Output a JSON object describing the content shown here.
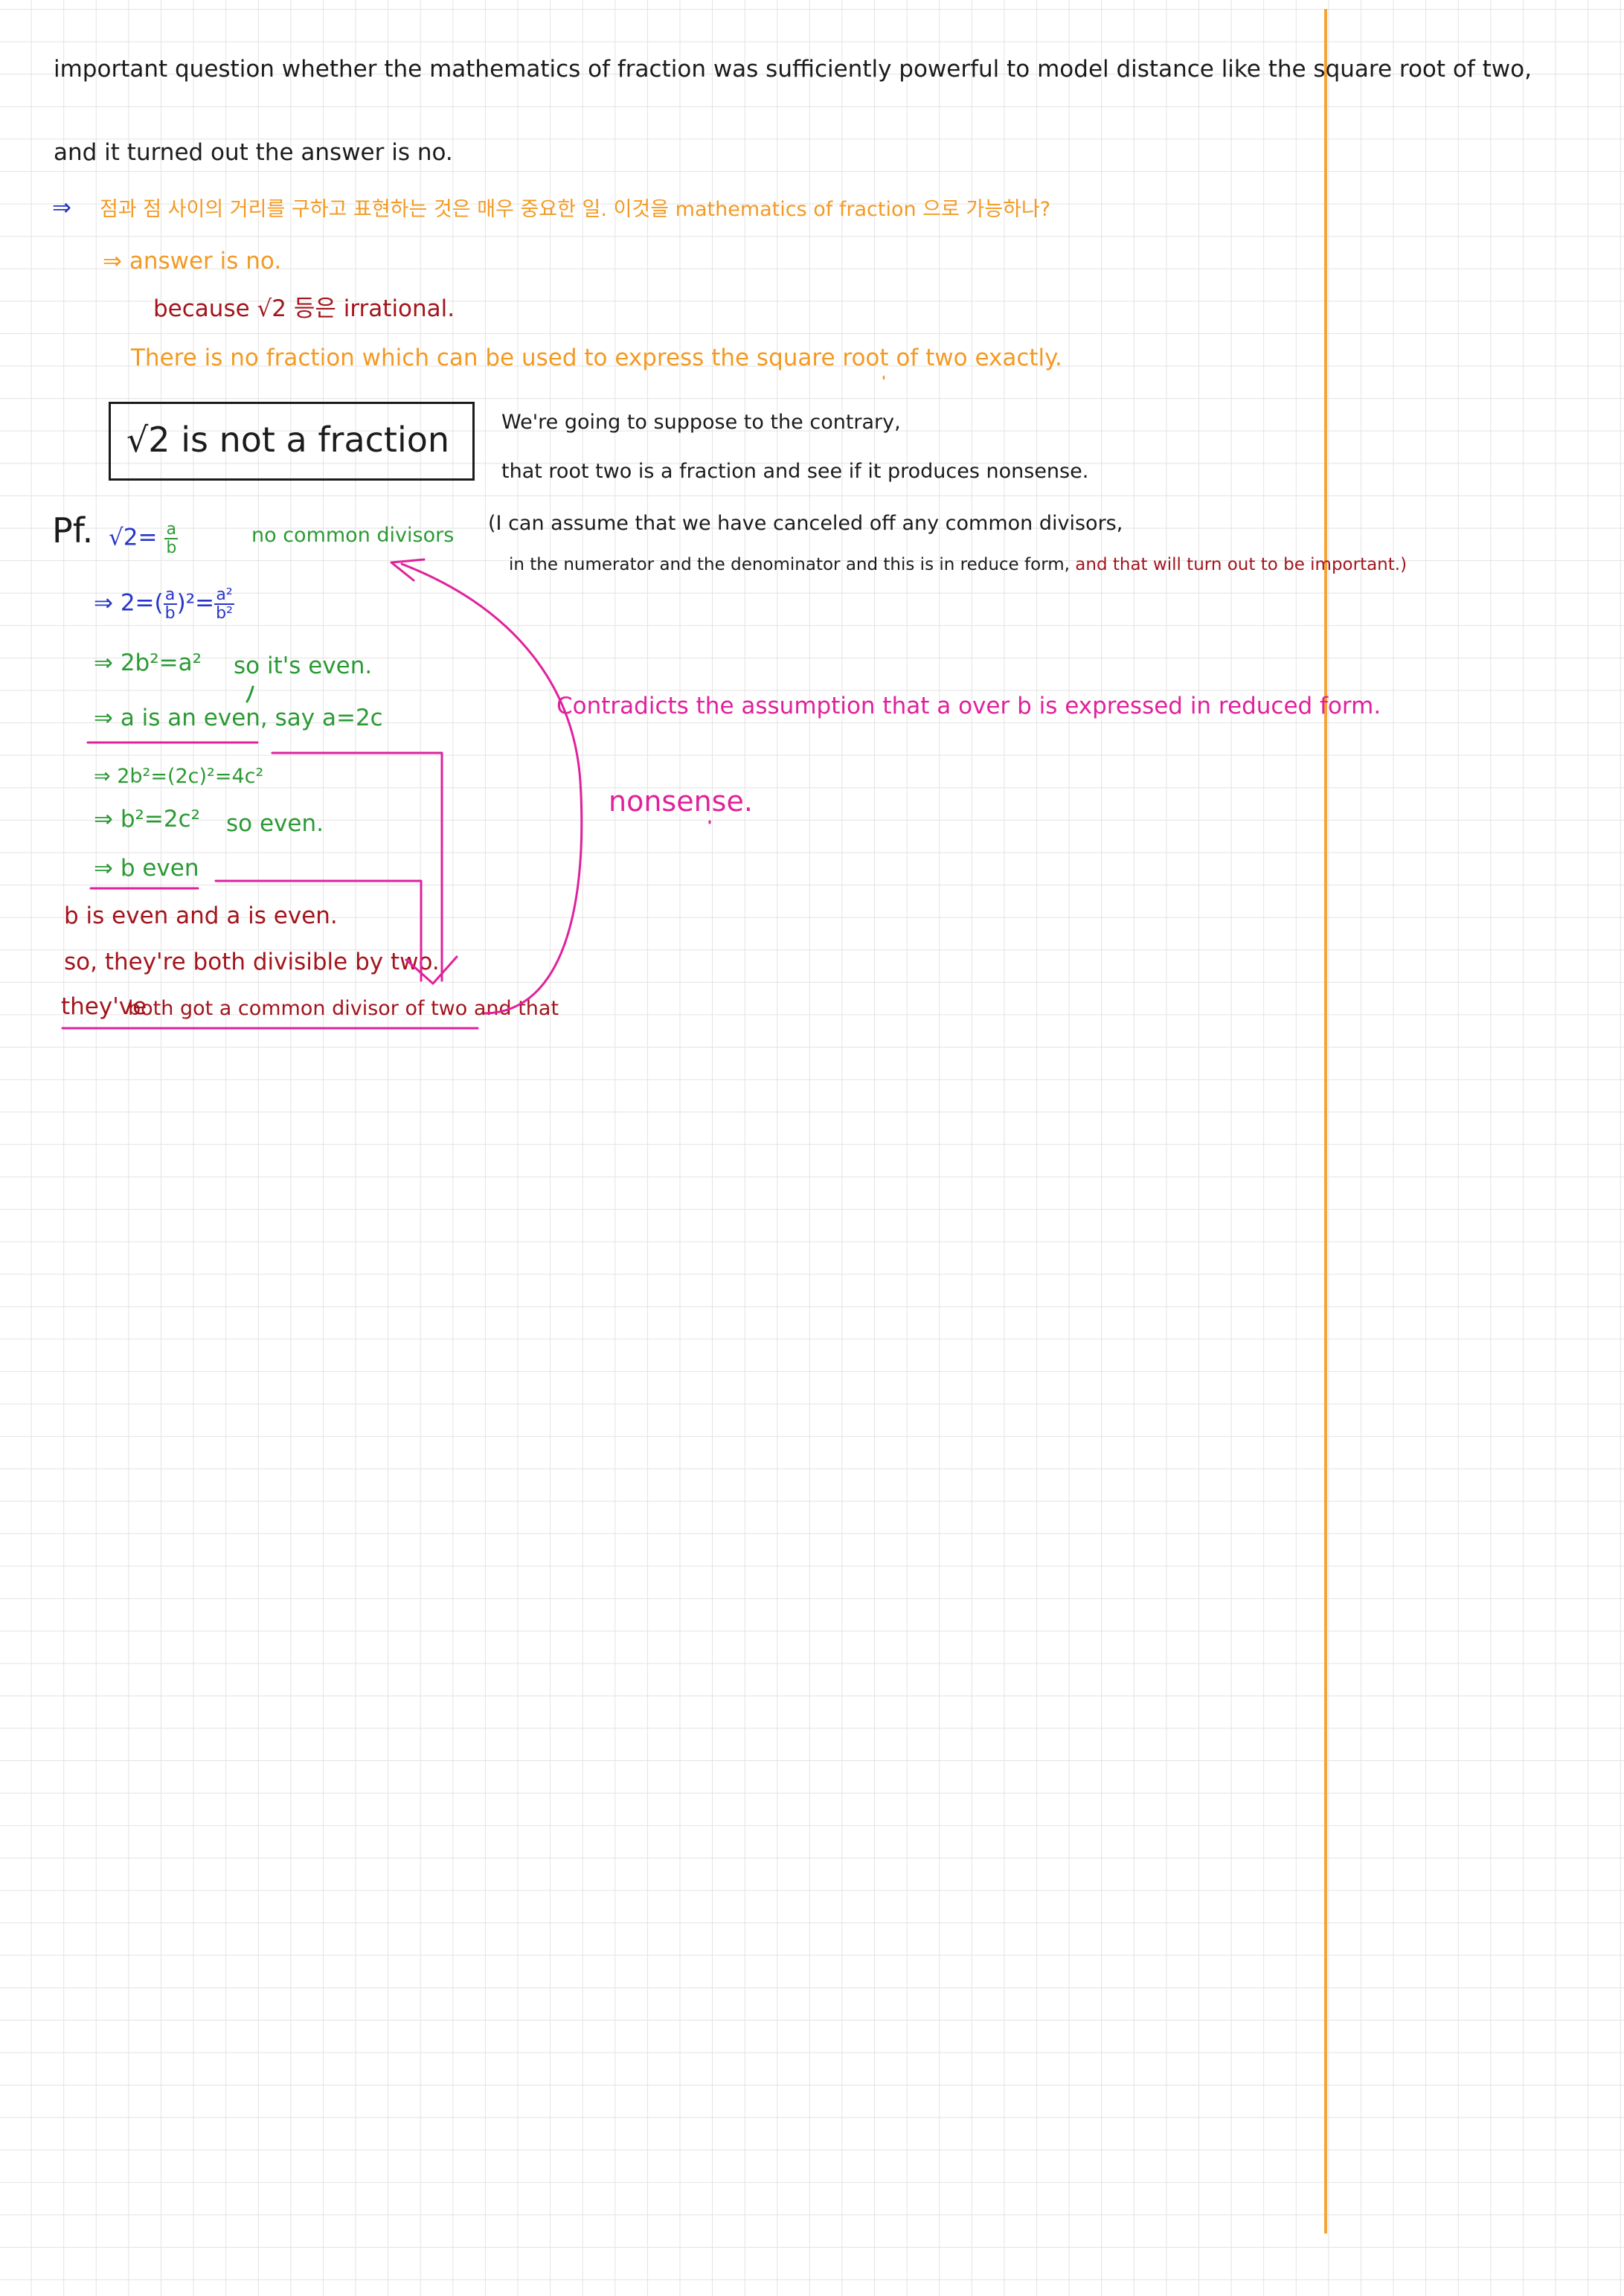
{
  "page": {
    "line1": "important question whether the mathematics of fraction was sufficiently powerful to model distance like the square root of two,",
    "line2": "and it turned out the answer is no."
  },
  "korean_note": {
    "arrow": "⇒",
    "text": "점과 점 사이의 거리를 구하고 표현하는 것은 매우 중요한 일. 이것을 mathematics of fraction 으로 가능하나?",
    "answer": "⇒ answer is no.",
    "because": "because √2 등은 irrational.",
    "no_fraction": "There is no fraction which can be used to express the square root of two exactly."
  },
  "box": {
    "title": "√2 is not a fraction"
  },
  "side_notes": {
    "suppose_1": "We're going to suppose to the contrary,",
    "suppose_2": "that root two is a fraction and see if it produces nonsense.",
    "assume_1": "(I can assume that we have canceled off any common divisors,",
    "assume_2": "in the numerator and the denominator and this is in reduce form,",
    "assume_3": "and that will turn out to be important.)",
    "contradicts": "Contradicts the assumption that a over b is expressed in reduced form.",
    "nonsense": "nonsense."
  },
  "proof": {
    "pf": "Pf.",
    "step1_lhs": "√2=",
    "a": "a",
    "b": "b",
    "no_common": "no common divisors",
    "step2_prefix": "⇒ 2=",
    "step2_paren": "(",
    "step2_close": ")²=",
    "a2": "a²",
    "b2": "b²",
    "step3": "⇒ 2b²=a²",
    "step3_note": "so it's even.",
    "step4": "⇒ a is an even, say a=2c",
    "step5": "⇒ 2b²=(2c)²=4c²",
    "step6": "⇒ b²=2c²",
    "step6_note": "so even.",
    "step7": "⇒ b even",
    "concl1": "b is even and a is even.",
    "concl2": "so, they're both divisible by two.",
    "concl3_a": "they've",
    "concl3_b": "both got a common divisor of two and that"
  },
  "colors": {
    "black": "#1b1b1b",
    "orange": "#f39a23",
    "blue": "#2735c9",
    "green": "#2b9a34",
    "red": "#a3141c",
    "pink": "#e0219c",
    "margin": "#f5a43a",
    "grid": "#e3e3e3"
  }
}
